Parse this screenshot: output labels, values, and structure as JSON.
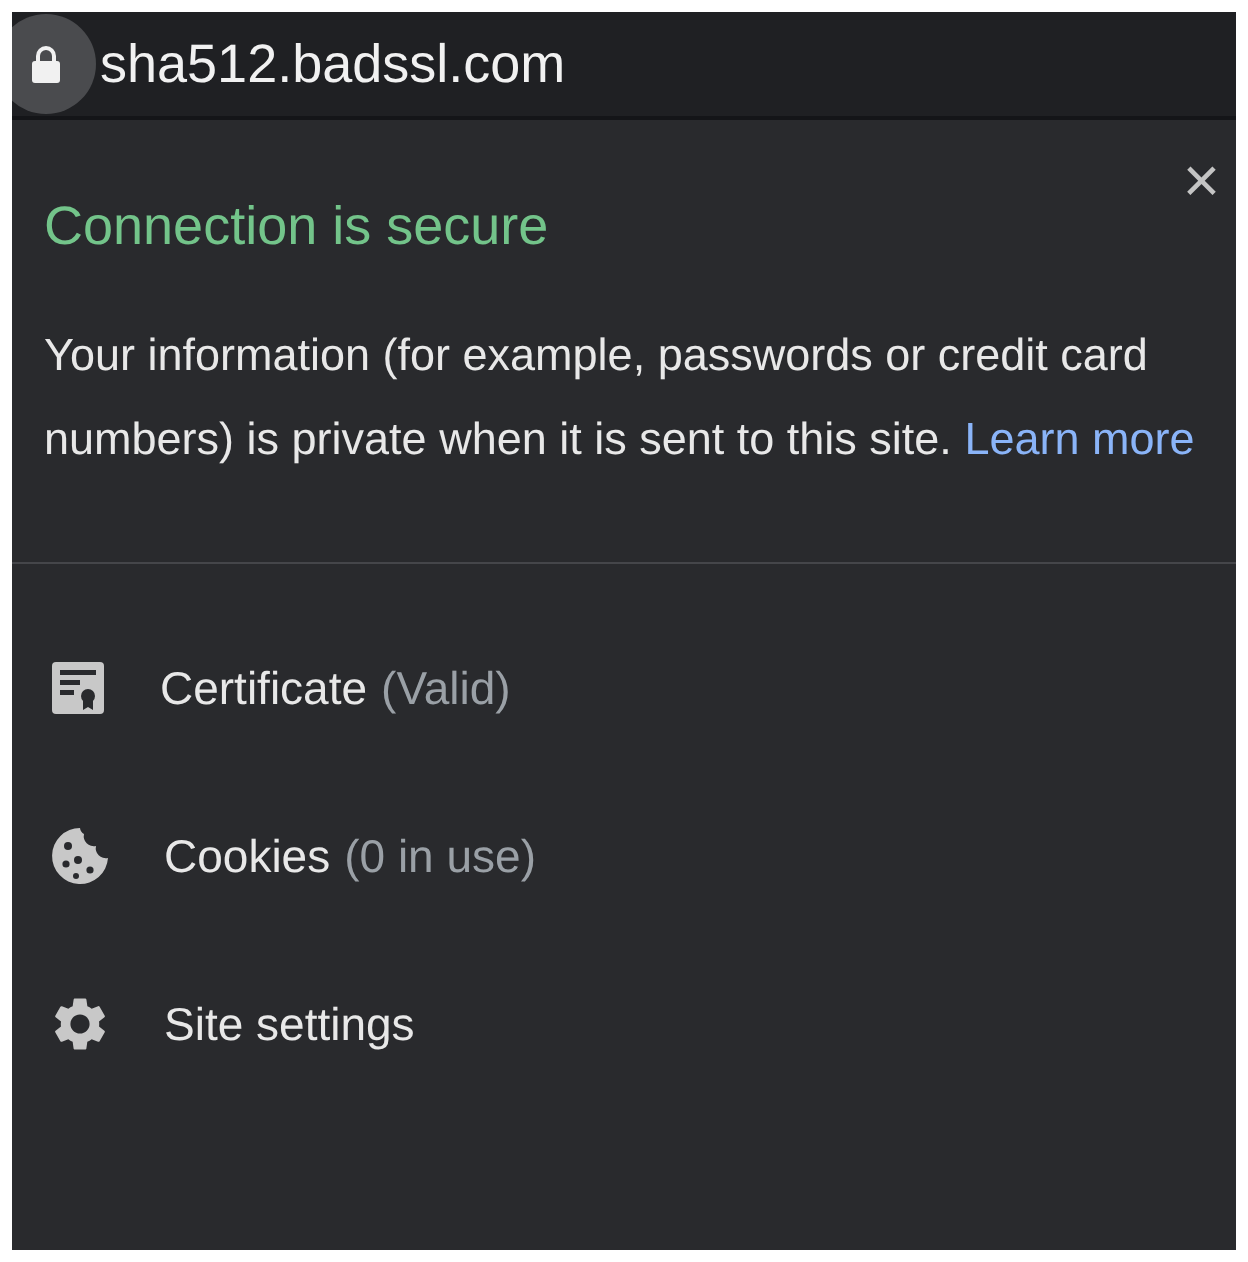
{
  "address_bar": {
    "url": "sha512.badssl.com"
  },
  "popup": {
    "close": "×",
    "title": "Connection is secure",
    "body": "Your information (for example, passwords or credit card numbers) is private when it is sent to this site.",
    "link": "Learn more",
    "items": [
      {
        "kind": "certificate",
        "label": "Certificate",
        "note": "(Valid)"
      },
      {
        "kind": "cookies",
        "label": "Cookies",
        "note": "(0 in use)"
      },
      {
        "kind": "settings",
        "label": "Site settings"
      }
    ]
  }
}
